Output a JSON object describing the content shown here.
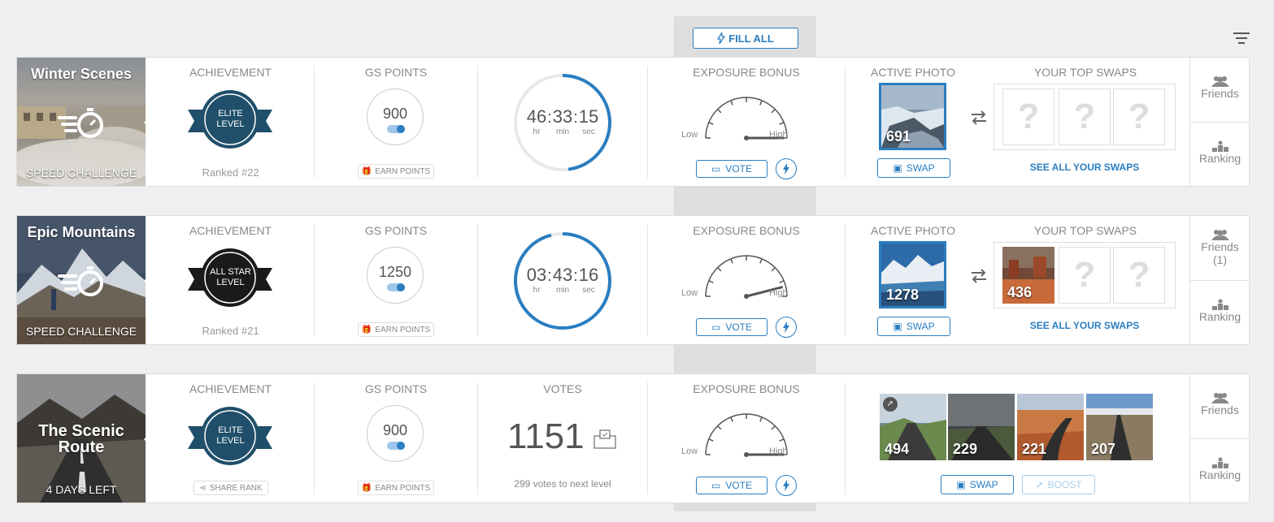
{
  "toolbar": {
    "fill_all_label": "FILL ALL"
  },
  "labels": {
    "achievement": "ACHIEVEMENT",
    "gs_points": "GS POINTS",
    "exposure_bonus": "EXPOSURE BONUS",
    "active_photo": "ACTIVE PHOTO",
    "your_top_swaps": "YOUR TOP SWAPS",
    "votes": "VOTES",
    "vote": "VOTE",
    "swap": "SWAP",
    "boost": "BOOST",
    "earn_points": "EARN POINTS",
    "share_rank": "SHARE RANK",
    "see_all_swaps": "SEE ALL YOUR SWAPS",
    "low": "Low",
    "high": "High",
    "hr": "hr",
    "min": "min",
    "sec": "sec",
    "friends": "Friends",
    "ranking": "Ranking",
    "question_mark": "?"
  },
  "challenges": [
    {
      "title": "Winter Scenes",
      "subtitle": "SPEED CHALLENGE",
      "level_top": "ELITE",
      "level_bottom": "LEVEL",
      "ranked": "Ranked #22",
      "gs_points": "900",
      "timer": {
        "hr": "46",
        "min": "33",
        "sec": "15",
        "progress": 0.48
      },
      "exposure": 0.5,
      "active_photo_count": "691",
      "swap_counts": [],
      "friends_label": "Friends",
      "accent": "#2a7ec1"
    },
    {
      "title": "Epic Mountains",
      "subtitle": "SPEED CHALLENGE",
      "level_top": "ALL STAR",
      "level_bottom": "LEVEL",
      "ranked": "Ranked #21",
      "gs_points": "1250",
      "timer": {
        "hr": "03",
        "min": "43",
        "sec": "16",
        "progress": 0.96
      },
      "exposure": 0.92,
      "active_photo_count": "1278",
      "swap_counts": [
        "436"
      ],
      "friends_label": "Friends",
      "friends_count": "(1)"
    },
    {
      "title": "The Scenic Route",
      "subtitle": "4 DAYS LEFT",
      "level_top": "ELITE",
      "level_bottom": "LEVEL",
      "gs_points": "900",
      "votes": "1151",
      "votes_to_next": "299 votes to next level",
      "exposure": 0.5,
      "photos": [
        "494",
        "229",
        "221",
        "207"
      ],
      "friends_label": "Friends"
    }
  ],
  "colors": {
    "accent": "#2a7ec1",
    "elite_badge": "#1f4f6a",
    "allstar_badge": "#1a1a1a"
  }
}
